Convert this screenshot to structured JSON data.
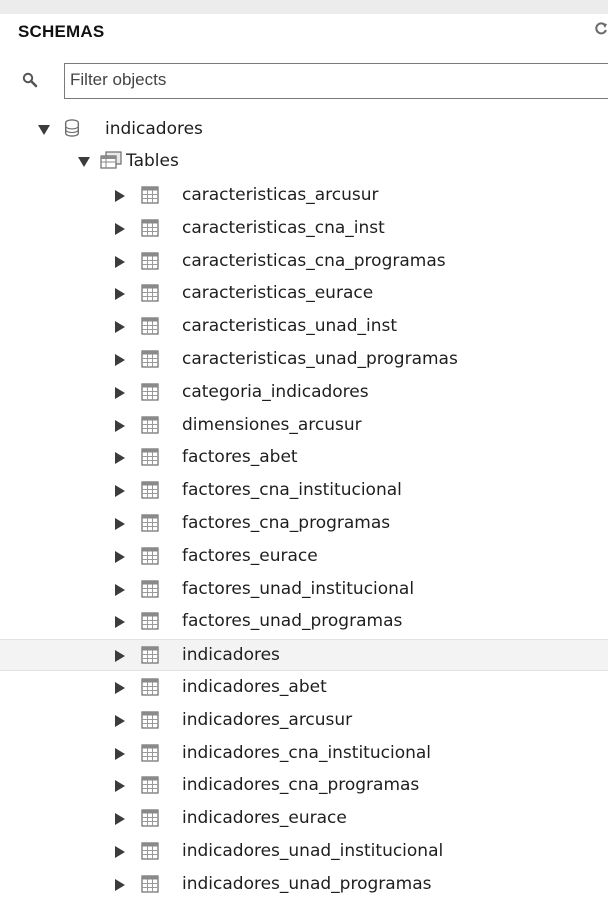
{
  "panel": {
    "title": "SCHEMAS",
    "filter_placeholder": "Filter objects"
  },
  "tree": {
    "schema": {
      "label": "indicadores",
      "expanded": true
    },
    "tables_folder": {
      "label": "Tables",
      "expanded": true
    },
    "tables": [
      "caracteristicas_arcusur",
      "caracteristicas_cna_inst",
      "caracteristicas_cna_programas",
      "caracteristicas_eurace",
      "caracteristicas_unad_inst",
      "caracteristicas_unad_programas",
      "categoria_indicadores",
      "dimensiones_arcusur",
      "factores_abet",
      "factores_cna_institucional",
      "factores_cna_programas",
      "factores_eurace",
      "factores_unad_institucional",
      "factores_unad_programas",
      "indicadores",
      "indicadores_abet",
      "indicadores_arcusur",
      "indicadores_cna_institucional",
      "indicadores_cna_programas",
      "indicadores_eurace",
      "indicadores_unad_institucional",
      "indicadores_unad_programas"
    ],
    "selected_table": "indicadores"
  }
}
